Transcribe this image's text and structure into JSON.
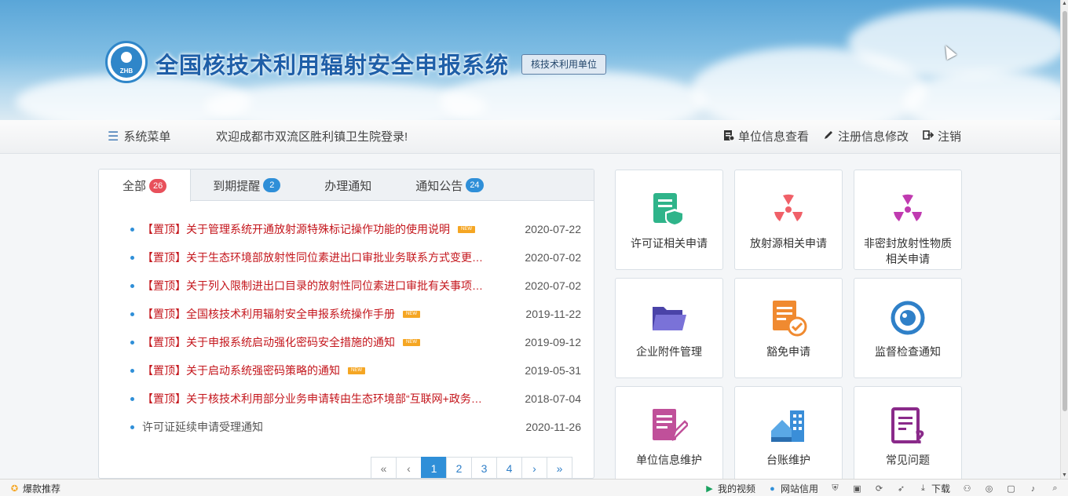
{
  "header": {
    "title": "全国核技术利用辐射安全申报系统",
    "logo_text": "ZHB",
    "role_badge": "核技术利用单位"
  },
  "nav": {
    "menu_label": "系统菜单",
    "welcome": "欢迎成都市双流区胜利镇卫生院登录!",
    "links": [
      "单位信息查看",
      "注册信息修改",
      "注销"
    ]
  },
  "tabs": [
    {
      "label": "全部",
      "count": "26",
      "color": "#e8505b"
    },
    {
      "label": "到期提醒",
      "count": "2",
      "color": "#2f8fd8"
    },
    {
      "label": "办理通知",
      "count": ""
    },
    {
      "label": "通知公告",
      "count": "24",
      "color": "#2f8fd8"
    }
  ],
  "news": [
    {
      "title": "【置顶】关于管理系统开通放射源特殊标记操作功能的使用说明",
      "date": "2020-07-22",
      "new": true,
      "new_text": "NEW"
    },
    {
      "title": "【置顶】关于生态环境部放射性同位素进出口审批业务联系方式变更的通知",
      "date": "2020-07-02",
      "new": false
    },
    {
      "title": "【置顶】关于列入限制进出口目录的放射性同位素进口审批有关事项的通知",
      "date": "2020-07-02",
      "new": false
    },
    {
      "title": "【置顶】全国核技术利用辐射安全申报系统操作手册",
      "date": "2019-11-22",
      "new": true,
      "new_text": "NEW"
    },
    {
      "title": "【置顶】关于申报系统启动强化密码安全措施的通知",
      "date": "2019-09-12",
      "new": true,
      "new_text": "NEW"
    },
    {
      "title": "【置顶】关于启动系统强密码策略的通知",
      "date": "2019-05-31",
      "new": true,
      "new_text": "NEW"
    },
    {
      "title": "【置顶】关于核技术利用部分业务申请转由生态环境部“互联网+政务服务”平台办理的通知",
      "date": "2018-07-04",
      "new": false
    },
    {
      "title": "许可证延续申请受理通知",
      "date": "2020-11-26",
      "new": false,
      "plain": true
    }
  ],
  "pager": [
    "«",
    "‹",
    "1",
    "2",
    "3",
    "4",
    "›",
    "»"
  ],
  "tiles": [
    {
      "label": "许可证相关申请",
      "icon": "license-shield-icon",
      "color": "#2fb48a"
    },
    {
      "label": "放射源相关申请",
      "icon": "radiation-icon",
      "color": "#f06068"
    },
    {
      "label": "非密封放射性物质相关申请",
      "icon": "radiation-icon",
      "color": "#c03ab0"
    },
    {
      "label": "企业附件管理",
      "icon": "folder-icon",
      "color": "#6b63c8"
    },
    {
      "label": "豁免申请",
      "icon": "document-check-icon",
      "color": "#f08a30"
    },
    {
      "label": "监督检查通知",
      "icon": "eye-icon",
      "color": "#2f80c8"
    },
    {
      "label": "单位信息维护",
      "icon": "edit-document-icon",
      "color": "#c0509a"
    },
    {
      "label": "台账维护",
      "icon": "building-icon",
      "color": "#3a8ed8"
    },
    {
      "label": "常见问题",
      "icon": "question-document-icon",
      "color": "#8a2a8a"
    }
  ],
  "statusbar": {
    "left": "爆款推荐",
    "items": [
      "我的视频",
      "网站信用",
      "下载"
    ]
  }
}
